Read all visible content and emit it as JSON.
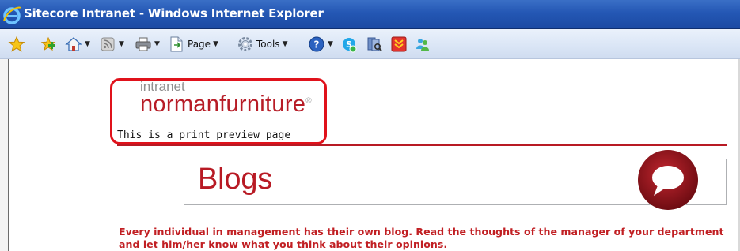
{
  "window": {
    "title": "Sitecore Intranet - Windows Internet Explorer"
  },
  "toolbar": {
    "items": [
      {
        "icon": "favorites-star-icon"
      },
      {
        "icon": "add-favorite-icon"
      },
      {
        "icon": "home-icon"
      },
      {
        "icon": "feeds-icon"
      },
      {
        "icon": "print-icon"
      },
      {
        "icon": "page-menu-icon",
        "label": "Page"
      },
      {
        "icon": "tools-gear-icon",
        "label": "Tools"
      },
      {
        "icon": "help-icon"
      },
      {
        "icon": "skype-icon"
      },
      {
        "icon": "research-icon"
      },
      {
        "icon": "download-icon"
      },
      {
        "icon": "messenger-icon"
      }
    ]
  },
  "page": {
    "logo": {
      "small": "intranet",
      "main": "normanfurniture",
      "registered": "®"
    },
    "print_note": "This is a print preview page",
    "heading": "Blogs",
    "description": "Every individual in management has their own blog. Read the thoughts of the manager of your department and let him/her know what you think about their opinions.",
    "colors": {
      "accent_red": "#b81a24",
      "highlight_red": "#e0121b",
      "titlebar_blue": "#2457b4"
    }
  }
}
